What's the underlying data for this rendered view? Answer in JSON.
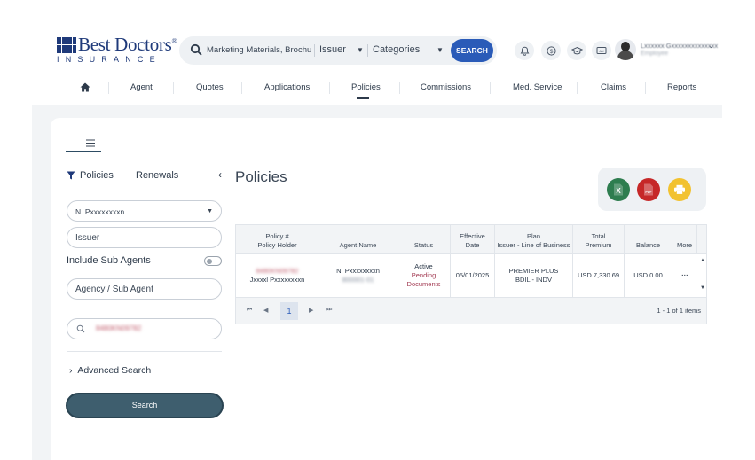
{
  "brand": {
    "name": "Best Doctors",
    "trademark": "®",
    "subtitle": "INSURANCE"
  },
  "search": {
    "query": "Marketing Materials, Brochur",
    "filter1": "Issuer",
    "filter2": "Categories",
    "button": "SEARCH"
  },
  "top_icons": [
    "bell-icon",
    "dollar-icon",
    "graduation-cap-icon",
    "id-card-icon"
  ],
  "user": {
    "name": "Lxxxxxx Gxxxxxxxxxxxxxx",
    "role": "Employee"
  },
  "nav": {
    "items": [
      "Agent",
      "Quotes",
      "Applications",
      "Policies",
      "Commissions",
      "Med. Service",
      "Claims",
      "Reports"
    ],
    "active": "Policies"
  },
  "panel": {
    "tabs": [
      "Policies",
      "Renewals"
    ],
    "agent_select": "N. Pxxxxxxxxn",
    "issuer_placeholder": "Issuer",
    "include_sub_agents": "Include Sub Agents",
    "include_sub_agents_on": false,
    "agency_placeholder": "Agency / Sub Agent",
    "policy_search_value": "8480KN09782",
    "advanced_search": "Advanced Search",
    "search_button": "Search"
  },
  "main": {
    "title": "Policies",
    "exports": [
      "excel-export-icon",
      "pdf-export-icon",
      "print-icon"
    ],
    "export_colors": {
      "excel": "#2e7d4f",
      "pdf": "#c62828",
      "print": "#f2c230"
    }
  },
  "table": {
    "headers": [
      [
        "Policy #",
        "Policy Holder"
      ],
      [
        "Agent Name"
      ],
      [
        "Status"
      ],
      [
        "Effective",
        "Date"
      ],
      [
        "Plan",
        "Issuer - Line of Business"
      ],
      [
        "Total",
        "Premium"
      ],
      [
        "Balance"
      ],
      [
        "More"
      ]
    ],
    "rows": [
      {
        "policy_number": "8480KN09782",
        "policy_holder": "Jxxxxl Pxxxxxxxxn",
        "agent_name": "N. Pxxxxxxxxn",
        "agent_code": "800001-01",
        "status": "Active",
        "status_detail_1": "Pending",
        "status_detail_2": "Documents",
        "effective_date": "05/01/2025",
        "plan": "PREMIER PLUS",
        "line_of_business": "BDIL - INDV",
        "total_premium": "USD 7,330.69",
        "balance": "USD 0.00",
        "more": "···"
      }
    ]
  },
  "pagination": {
    "current_page": "1",
    "info": "1 - 1 of 1 items"
  }
}
